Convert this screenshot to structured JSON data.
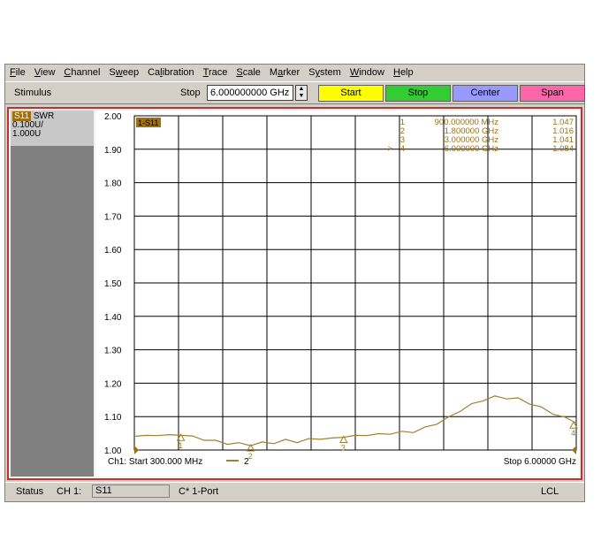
{
  "menu": [
    {
      "label": "File",
      "u": "F",
      "rest": "ile"
    },
    {
      "label": "View",
      "u": "V",
      "rest": "iew"
    },
    {
      "label": "Channel",
      "u": "C",
      "rest": "hannel"
    },
    {
      "label": "Sweep",
      "pre": "S",
      "u": "w",
      "rest": "eep"
    },
    {
      "label": "Calibration",
      "pre": "Ca",
      "u": "l",
      "rest": "ibration"
    },
    {
      "label": "Trace",
      "u": "T",
      "rest": "race"
    },
    {
      "label": "Scale",
      "u": "S",
      "rest": "cale"
    },
    {
      "label": "Marker",
      "pre": "M",
      "u": "a",
      "rest": "rker"
    },
    {
      "label": "System",
      "pre": "S",
      "u": "y",
      "rest": "stem"
    },
    {
      "label": "Window",
      "u": "W",
      "rest": "indow"
    },
    {
      "label": "Help",
      "u": "H",
      "rest": "elp"
    }
  ],
  "toolbar": {
    "stimulus_label": "Stimulus",
    "stop_label": "Stop",
    "stop_value": "6.000000000 GHz",
    "start_btn": "Start",
    "stop_btn": "Stop",
    "center_btn": "Center",
    "span_btn": "Span"
  },
  "trace_panel": {
    "tag": "S11",
    "format": "SWR",
    "scale": "0.100U/",
    "ref": "1.000U"
  },
  "colors": {
    "trace": "#a08030",
    "marker_text": "#a07010",
    "frame": "#b33333"
  },
  "status": {
    "label": "Status",
    "channel": "CH 1:",
    "param": "S11",
    "cal": "C* 1-Port",
    "mode": "LCL"
  },
  "chart_data": {
    "type": "line",
    "trace_label": "1-S11",
    "y_ticks": [
      "2.00",
      "1.90",
      "1.80",
      "1.70",
      "1.60",
      "1.50",
      "1.40",
      "1.30",
      "1.20",
      "1.10",
      "1.00"
    ],
    "ylim": [
      1.0,
      2.0
    ],
    "xlim_mhz": [
      300,
      6000
    ],
    "start_text": "Ch1: Start  300.000 MHz",
    "stop_text": "Stop  6.00000 GHz",
    "active_marker_legend": "2",
    "markers": [
      {
        "num": "1",
        "prefix": "",
        "freq_text": "900.000000 MHz",
        "value_text": "1.047",
        "freq_mhz": 900,
        "value": 1.047
      },
      {
        "num": "2",
        "prefix": "",
        "freq_text": "1.800000 GHz",
        "value_text": "1.016",
        "freq_mhz": 1800,
        "value": 1.016
      },
      {
        "num": "3",
        "prefix": "",
        "freq_text": "3.000000 GHz",
        "value_text": "1.041",
        "freq_mhz": 3000,
        "value": 1.041
      },
      {
        "num": "4",
        "prefix": ">",
        "freq_text": "6.000000 GHz",
        "value_text": "1.084",
        "freq_mhz": 6000,
        "value": 1.084
      }
    ],
    "series": [
      {
        "x": [
          300,
          450,
          600,
          750,
          900,
          1050,
          1200,
          1350,
          1500,
          1650,
          1800,
          1950,
          2100,
          2250,
          2400,
          2550,
          2700,
          2850,
          3000,
          3150,
          3300,
          3450,
          3600,
          3750,
          3900,
          4050,
          4200,
          4350,
          4500,
          4650,
          4800,
          4950,
          5100,
          5250,
          5400,
          5550,
          5700,
          5850,
          6000
        ],
        "values": [
          1.044,
          1.04,
          1.046,
          1.042,
          1.047,
          1.038,
          1.032,
          1.025,
          1.02,
          1.018,
          1.016,
          1.02,
          1.022,
          1.028,
          1.025,
          1.03,
          1.035,
          1.032,
          1.041,
          1.04,
          1.046,
          1.045,
          1.05,
          1.052,
          1.055,
          1.065,
          1.08,
          1.095,
          1.118,
          1.135,
          1.15,
          1.158,
          1.156,
          1.152,
          1.14,
          1.125,
          1.11,
          1.095,
          1.084
        ]
      }
    ]
  }
}
